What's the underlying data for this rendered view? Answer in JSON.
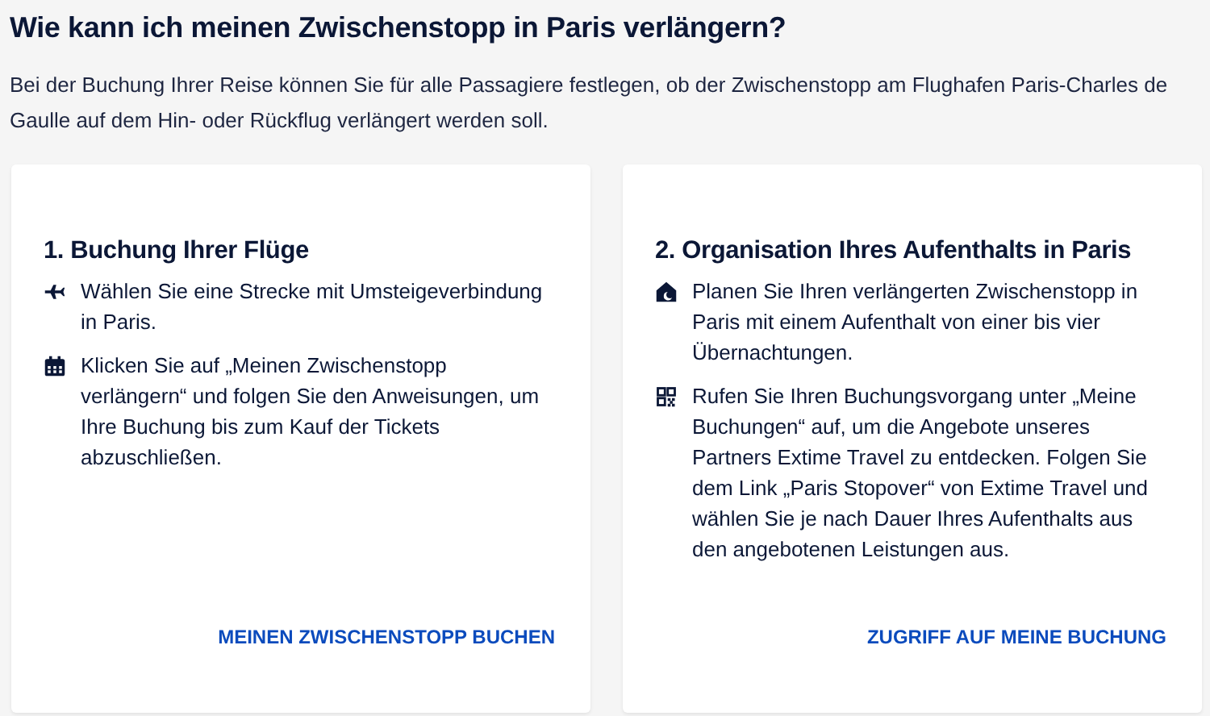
{
  "title": "Wie kann ich meinen Zwischenstopp in Paris verlängern?",
  "intro": "Bei der Buchung Ihrer Reise können Sie für alle Passagiere festlegen, ob der Zwischenstopp am Flughafen Paris-Charles de Gaulle auf dem Hin- oder Rückflug verlängert werden soll.",
  "cards": [
    {
      "title": "1. Buchung Ihrer Flüge",
      "items": [
        {
          "kind": "plane",
          "text": "Wählen Sie eine Strecke mit Umsteigeverbindung in Paris."
        },
        {
          "kind": "calendar",
          "text": "Klicken Sie auf „Meinen Zwischenstopp verlängern“ und folgen Sie den Anweisungen, um Ihre Buchung bis zum Kauf der Tickets abzuschließen."
        }
      ],
      "link": "MEINEN ZWISCHENSTOPP BUCHEN"
    },
    {
      "title": "2. Organisation Ihres Aufenthalts in Paris",
      "items": [
        {
          "kind": "night",
          "text": "Planen Sie Ihren verlängerten Zwischenstopp in Paris mit einem Aufenthalt von einer bis vier Übernachtungen."
        },
        {
          "kind": "qr",
          "text": "Rufen Sie Ihren Buchungsvorgang unter „Meine Buchungen“ auf, um die Angebote unseres Partners Extime Travel zu entdecken. Folgen Sie dem Link „Paris Stopover“ von Extime Travel und wählen Sie je nach Dauer Ihres Aufenthalts aus den angebotenen Leistungen aus."
        }
      ],
      "link": "ZUGRIFF AUF MEINE BUCHUNG"
    }
  ]
}
